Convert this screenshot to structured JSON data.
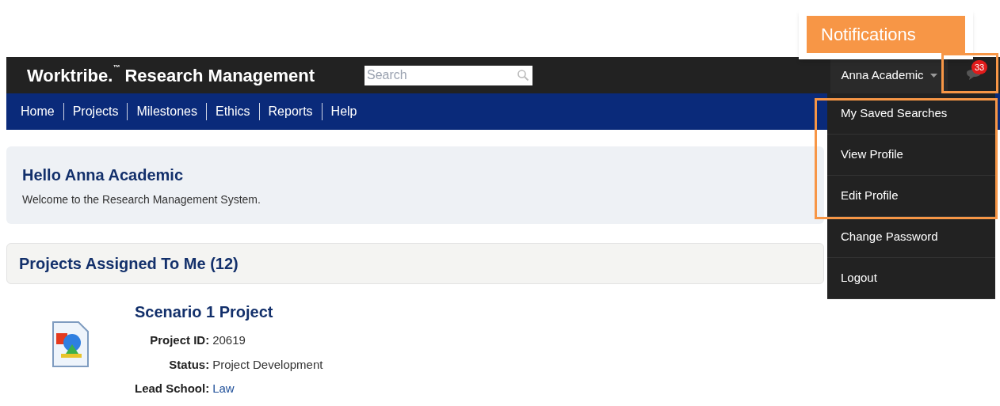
{
  "header": {
    "brand": "Worktribe.",
    "trademark": "™",
    "product": "Research Management",
    "search": {
      "placeholder": "Search"
    },
    "user": "Anna Academic",
    "notification_count": "33"
  },
  "nav": [
    "Home",
    "Projects",
    "Milestones",
    "Ethics",
    "Reports",
    "Help"
  ],
  "user_menu": [
    "My Saved Searches",
    "View Profile",
    "Edit Profile",
    "Change Password",
    "Logout"
  ],
  "welcome": {
    "title": "Hello Anna Academic",
    "text": "Welcome to the Research Management System."
  },
  "projects": {
    "title": "Projects Assigned To Me (12)",
    "items": [
      {
        "name": "Scenario 1 Project",
        "fields": [
          {
            "label": "Project ID:",
            "value": "20619",
            "kind": "text"
          },
          {
            "label": "Status:",
            "value": "Project Development",
            "kind": "text"
          },
          {
            "label": "Lead School:",
            "value": "Law",
            "kind": "link"
          }
        ]
      }
    ]
  },
  "annotation": {
    "label": "Notifications"
  }
}
